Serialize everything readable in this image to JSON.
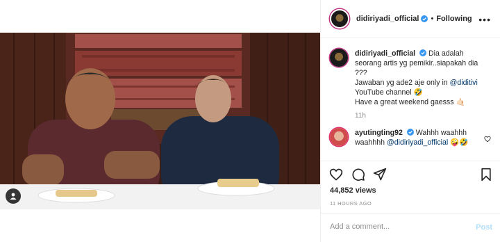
{
  "post": {
    "username": "didiriyadi_official",
    "follow_state": "Following",
    "dot": "•",
    "more": "•••"
  },
  "caption": {
    "username": "didiriyadi_official",
    "line1": "Dia adalah seorang artis yg pemikir..siapakah dia ???",
    "line2_prefix": "Jawaban yg ade2 aje only in ",
    "line2_mention": "@diditivi",
    "line2_suffix": " YouTube channel 🤣",
    "line3": "Have a great weekend gaesss 🤙🏻",
    "age": "11h"
  },
  "comment": {
    "username": "ayutingting92",
    "text": "Wahhh waahhh waahhhh ",
    "mention": "@didiriyadi_official",
    "tail": " 🤪🤣"
  },
  "stats": {
    "views": "44,852 views",
    "timestamp": "11 HOURS AGO"
  },
  "composer": {
    "placeholder": "Add a comment...",
    "post_label": "Post"
  },
  "colors": {
    "verified": "#3897f0",
    "post_disabled": "#b2dffc",
    "muted": "#8e8e8e",
    "mention": "#00376b"
  }
}
